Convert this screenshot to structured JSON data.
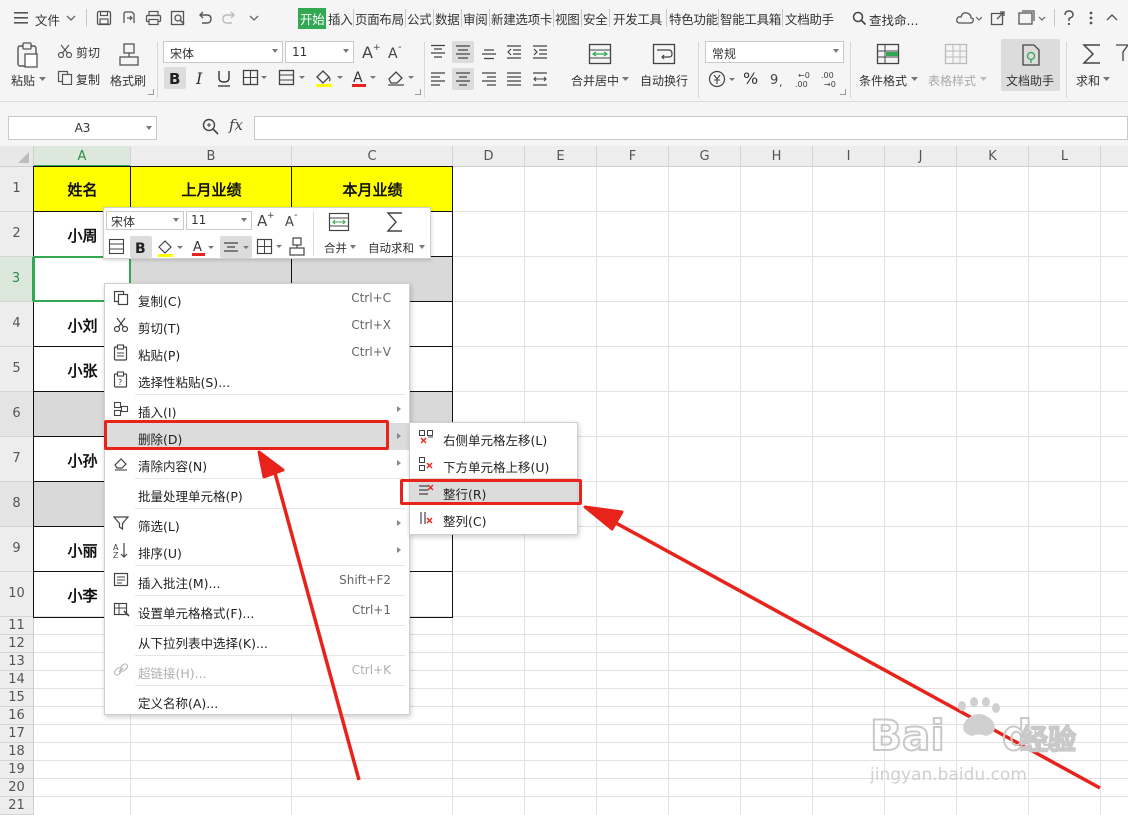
{
  "menubar": {
    "file_label": "文件",
    "tabs": [
      "开始",
      "插入",
      "页面布局",
      "公式",
      "数据",
      "审阅",
      "新建选项卡",
      "视图",
      "安全",
      "开发工具",
      "特色功能",
      "智能工具箱",
      "文档助手"
    ],
    "active_tab": "开始",
    "search_label": "查找命..."
  },
  "ribbon": {
    "paste_label": "粘贴",
    "cut_label": "剪切",
    "copy_label": "复制",
    "format_painter_label": "格式刷",
    "font_name": "宋体",
    "font_size": "11",
    "grow_font_label": "A⁺",
    "shrink_font_label": "A⁻",
    "merge_center_label": "合并居中",
    "wrap_text_label": "自动换行",
    "number_format": "常规",
    "percent_label": "%",
    "conditional_format_label": "条件格式",
    "table_style_label": "表格样式",
    "doc_assistant_label": "文档助手",
    "sum_label": "求和"
  },
  "formulabar": {
    "name_box": "A3",
    "fx_label": "fx",
    "formula": ""
  },
  "grid": {
    "columns": [
      "A",
      "B",
      "C",
      "D",
      "E",
      "F",
      "G",
      "H",
      "I",
      "J",
      "K",
      "L"
    ],
    "rows": [
      "1",
      "2",
      "3",
      "4",
      "5",
      "6",
      "7",
      "8",
      "9",
      "10",
      "11",
      "12",
      "13",
      "14",
      "15",
      "16",
      "17",
      "18",
      "19",
      "20",
      "21"
    ],
    "header_cells": [
      "姓名",
      "上月业绩",
      "本月业绩"
    ],
    "names": {
      "r2": "小周",
      "r4": "小刘",
      "r5": "小张",
      "r7": "小孙",
      "r9": "小丽",
      "r10": "小李"
    }
  },
  "mini_toolbar": {
    "font_name": "宋体",
    "font_size": "11",
    "merge_label": "合并",
    "autosum_label": "自动求和"
  },
  "context_menu": {
    "items": [
      {
        "label": "复制(C)",
        "shortcut": "Ctrl+C"
      },
      {
        "label": "剪切(T)",
        "shortcut": "Ctrl+X"
      },
      {
        "label": "粘贴(P)",
        "shortcut": "Ctrl+V"
      },
      {
        "label": "选择性粘贴(S)...",
        "shortcut": ""
      },
      {
        "label": "插入(I)",
        "shortcut": ""
      },
      {
        "label": "删除(D)",
        "shortcut": ""
      },
      {
        "label": "清除内容(N)",
        "shortcut": ""
      },
      {
        "label": "批量处理单元格(P)",
        "shortcut": ""
      },
      {
        "label": "筛选(L)",
        "shortcut": ""
      },
      {
        "label": "排序(U)",
        "shortcut": ""
      },
      {
        "label": "插入批注(M)...",
        "shortcut": "Shift+F2"
      },
      {
        "label": "设置单元格格式(F)...",
        "shortcut": "Ctrl+1"
      },
      {
        "label": "从下拉列表中选择(K)...",
        "shortcut": ""
      },
      {
        "label": "超链接(H)...",
        "shortcut": "Ctrl+K"
      },
      {
        "label": "定义名称(A)...",
        "shortcut": ""
      }
    ]
  },
  "delete_submenu": {
    "items": [
      {
        "label": "右侧单元格左移(L)"
      },
      {
        "label": "下方单元格上移(U)"
      },
      {
        "label": "整行(R)"
      },
      {
        "label": "整列(C)"
      }
    ]
  },
  "watermark": {
    "brand": "Bai",
    "brand_suffix": "du",
    "cn": "经验",
    "url": "jingyan.baidu.com"
  },
  "colors": {
    "accent_green": "#33a852",
    "header_yellow": "#ffff00",
    "annotation_red": "#e8231b"
  }
}
